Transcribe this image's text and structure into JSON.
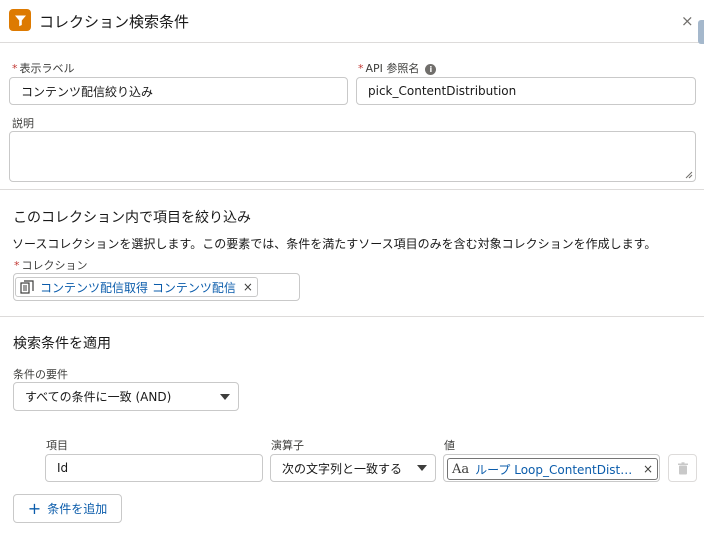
{
  "header": {
    "title": "コレクション検索条件",
    "close_glyph": "×",
    "icon": "filter-icon",
    "icon_color": "#dd7a01"
  },
  "fields": {
    "label_label": "表示ラベル",
    "label_value": "コンテンツ配信絞り込み",
    "api_label": "API 参照名",
    "api_value": "pick_ContentDistribution",
    "description_label": "説明",
    "required_mark": "*"
  },
  "filter_section": {
    "title": "このコレクション内で項目を絞り込み",
    "help_text": "ソースコレクションを選択します。この要素では、条件を満たすソース項目のみを含む対象コレクションを作成します。",
    "collection_label": "コレクション",
    "collection_value": "コンテンツ配信取得 コンテンツ配信",
    "collection_icon": "collection-icon",
    "remove_glyph": "×"
  },
  "conditions": {
    "title": "検索条件を適用",
    "requirement_label": "条件の要件",
    "requirement_value": "すべての条件に一致 (AND)",
    "field_label": "項目",
    "field_value": "Id",
    "operator_label": "演算子",
    "operator_value": "次の文字列と一致する",
    "value_label": "値",
    "value_value": "ループ Loop_ContentDistribut...",
    "value_type_glyph": "Aa",
    "remove_glyph": "×",
    "add_label": "条件を追加",
    "add_glyph": "+"
  },
  "colors": {
    "accent": "#dd7a01",
    "link": "#0b5cab",
    "required": "#c23934",
    "border": "#c9c9c9"
  }
}
